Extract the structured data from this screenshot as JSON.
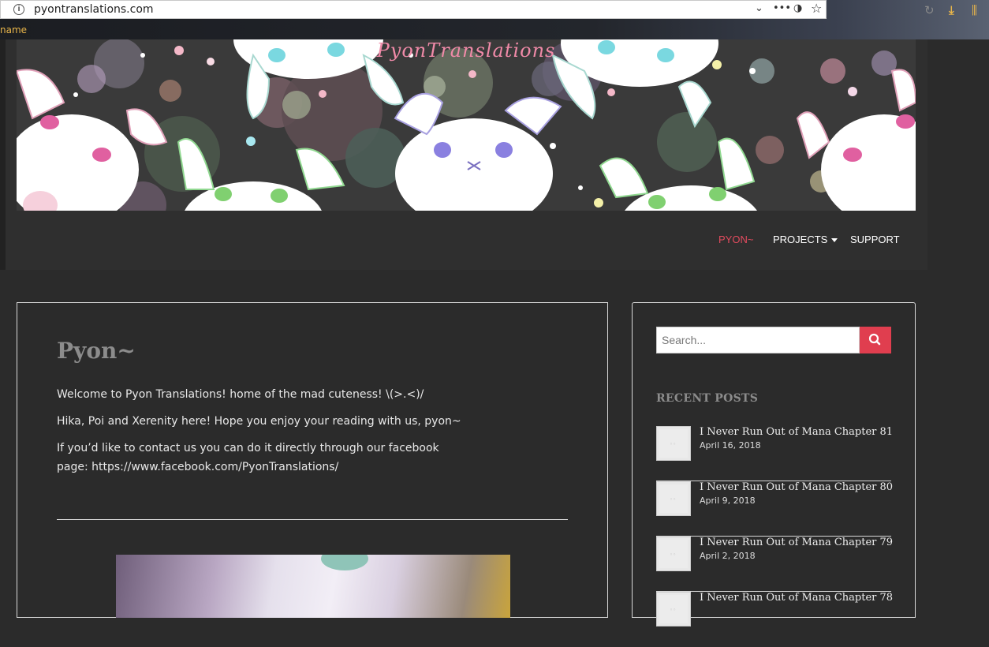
{
  "browser": {
    "url": "pyontranslations.com",
    "bookmark_label": "name"
  },
  "header": {
    "site_title": "PyonTranslations"
  },
  "nav": {
    "items": [
      {
        "label": "PYON~",
        "active": true
      },
      {
        "label": "PROJECTS",
        "has_dropdown": true
      },
      {
        "label": "SUPPORT"
      }
    ]
  },
  "main": {
    "title": "Pyon~",
    "paragraphs": [
      "Welcome to Pyon Translations! home of the mad cuteness! \\(>.<)/",
      "Hika, Poi and Xerenity here! Hope you enjoy your reading with us, pyon~",
      "If you’d like to contact us you can do it directly through our facebook",
      "page: https://www.facebook.com/PyonTranslations/"
    ]
  },
  "sidebar": {
    "search_placeholder": "Search...",
    "recent_heading": "RECENT POSTS",
    "posts": [
      {
        "title": "I Never Run Out of Mana Chapter 81",
        "date": "April 16, 2018"
      },
      {
        "title": "I Never Run Out of Mana Chapter 80",
        "date": "April 9, 2018"
      },
      {
        "title": "I Never Run Out of Mana Chapter 79",
        "date": "April 2, 2018"
      },
      {
        "title": "I Never Run Out of Mana Chapter 78",
        "date": ""
      }
    ]
  },
  "colors": {
    "accent": "#e03e4f",
    "nav_active": "#e24b5e",
    "background": "#2b2b2b"
  }
}
